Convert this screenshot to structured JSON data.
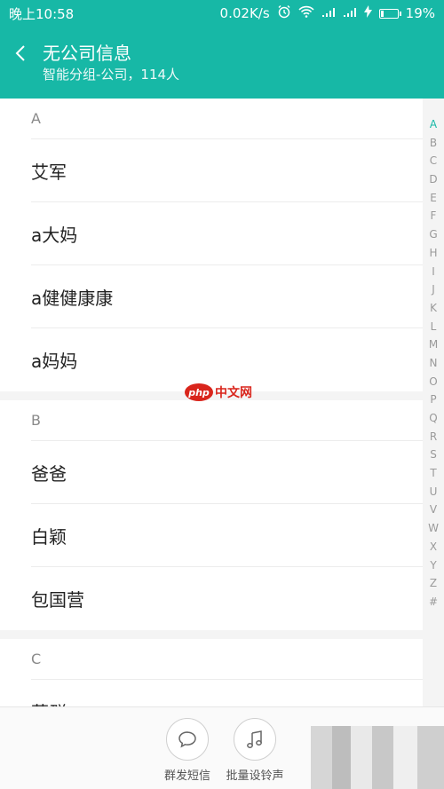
{
  "status_bar": {
    "time": "晚上10:58",
    "speed": "0.02K/s",
    "battery_percent": "19%",
    "battery_level": 0.19,
    "icons": [
      "alarm-icon",
      "wifi-icon",
      "signal-icon",
      "signal-icon",
      "charging-icon",
      "battery-icon"
    ]
  },
  "header": {
    "title": "无公司信息",
    "subtitle": "智能分组-公司，114人"
  },
  "sections": [
    {
      "letter": "A",
      "contacts": [
        "艾军",
        "a大妈",
        "a健健康康",
        "a妈妈"
      ]
    },
    {
      "letter": "B",
      "contacts": [
        "爸爸",
        "白颖",
        "包国营"
      ]
    },
    {
      "letter": "C",
      "contacts": [
        "蔡群"
      ]
    }
  ],
  "alpha_index": {
    "letters": [
      "A",
      "B",
      "C",
      "D",
      "E",
      "F",
      "G",
      "H",
      "I",
      "J",
      "K",
      "L",
      "M",
      "N",
      "O",
      "P",
      "Q",
      "R",
      "S",
      "T",
      "U",
      "V",
      "W",
      "X",
      "Y",
      "Z",
      "#"
    ],
    "active": "A"
  },
  "watermark": {
    "logo": "php",
    "text": "中文网"
  },
  "bottom_actions": [
    {
      "label": "群发短信",
      "icon": "chat-bubble-icon"
    },
    {
      "label": "批量设铃声",
      "icon": "music-note-icon"
    }
  ],
  "colors": {
    "accent": "#17b8a6",
    "watermark": "#d9251c"
  }
}
